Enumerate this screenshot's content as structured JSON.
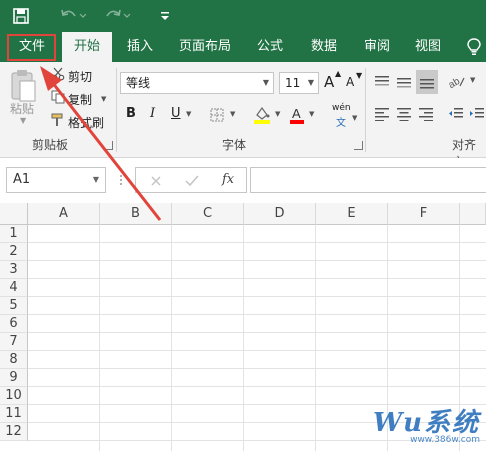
{
  "colors": {
    "excel_green": "#217346",
    "highlight_red": "#e0443a",
    "arrow_red": "#e0443a"
  },
  "quick_access": {
    "icons": [
      "save-icon",
      "undo-icon",
      "redo-icon",
      "customize-icon"
    ]
  },
  "tabs": [
    {
      "label": "文件",
      "active": false,
      "highlighted": true
    },
    {
      "label": "开始",
      "active": true
    },
    {
      "label": "插入"
    },
    {
      "label": "页面布局"
    },
    {
      "label": "公式"
    },
    {
      "label": "数据"
    },
    {
      "label": "审阅"
    },
    {
      "label": "视图"
    }
  ],
  "ribbon": {
    "clipboard": {
      "paste_label": "粘贴",
      "cut_label": "剪切",
      "copy_label": "复制",
      "format_painter_label": "格式刷",
      "group_label": "剪贴板"
    },
    "font": {
      "font_name": "等线",
      "font_size": "11",
      "bold": "B",
      "italic": "I",
      "underline": "U",
      "grow_font": "A",
      "shrink_font": "A",
      "font_color_letter": "A",
      "font_color": "#ff0000",
      "fill_color": "#ffff00",
      "phonetic_label": "wén",
      "phonetic_char": "文",
      "group_label": "字体"
    },
    "alignment": {
      "group_label": "对齐方"
    }
  },
  "formula_bar": {
    "name_box": "A1",
    "fx_label": "fx",
    "formula": ""
  },
  "grid": {
    "columns": [
      "A",
      "B",
      "C",
      "D",
      "E",
      "F"
    ],
    "rows": [
      "1",
      "2",
      "3",
      "4",
      "5",
      "6",
      "7",
      "8",
      "9",
      "10",
      "11",
      "12"
    ]
  },
  "watermark": {
    "text": "Wu系统",
    "url": "www.386w.com"
  }
}
